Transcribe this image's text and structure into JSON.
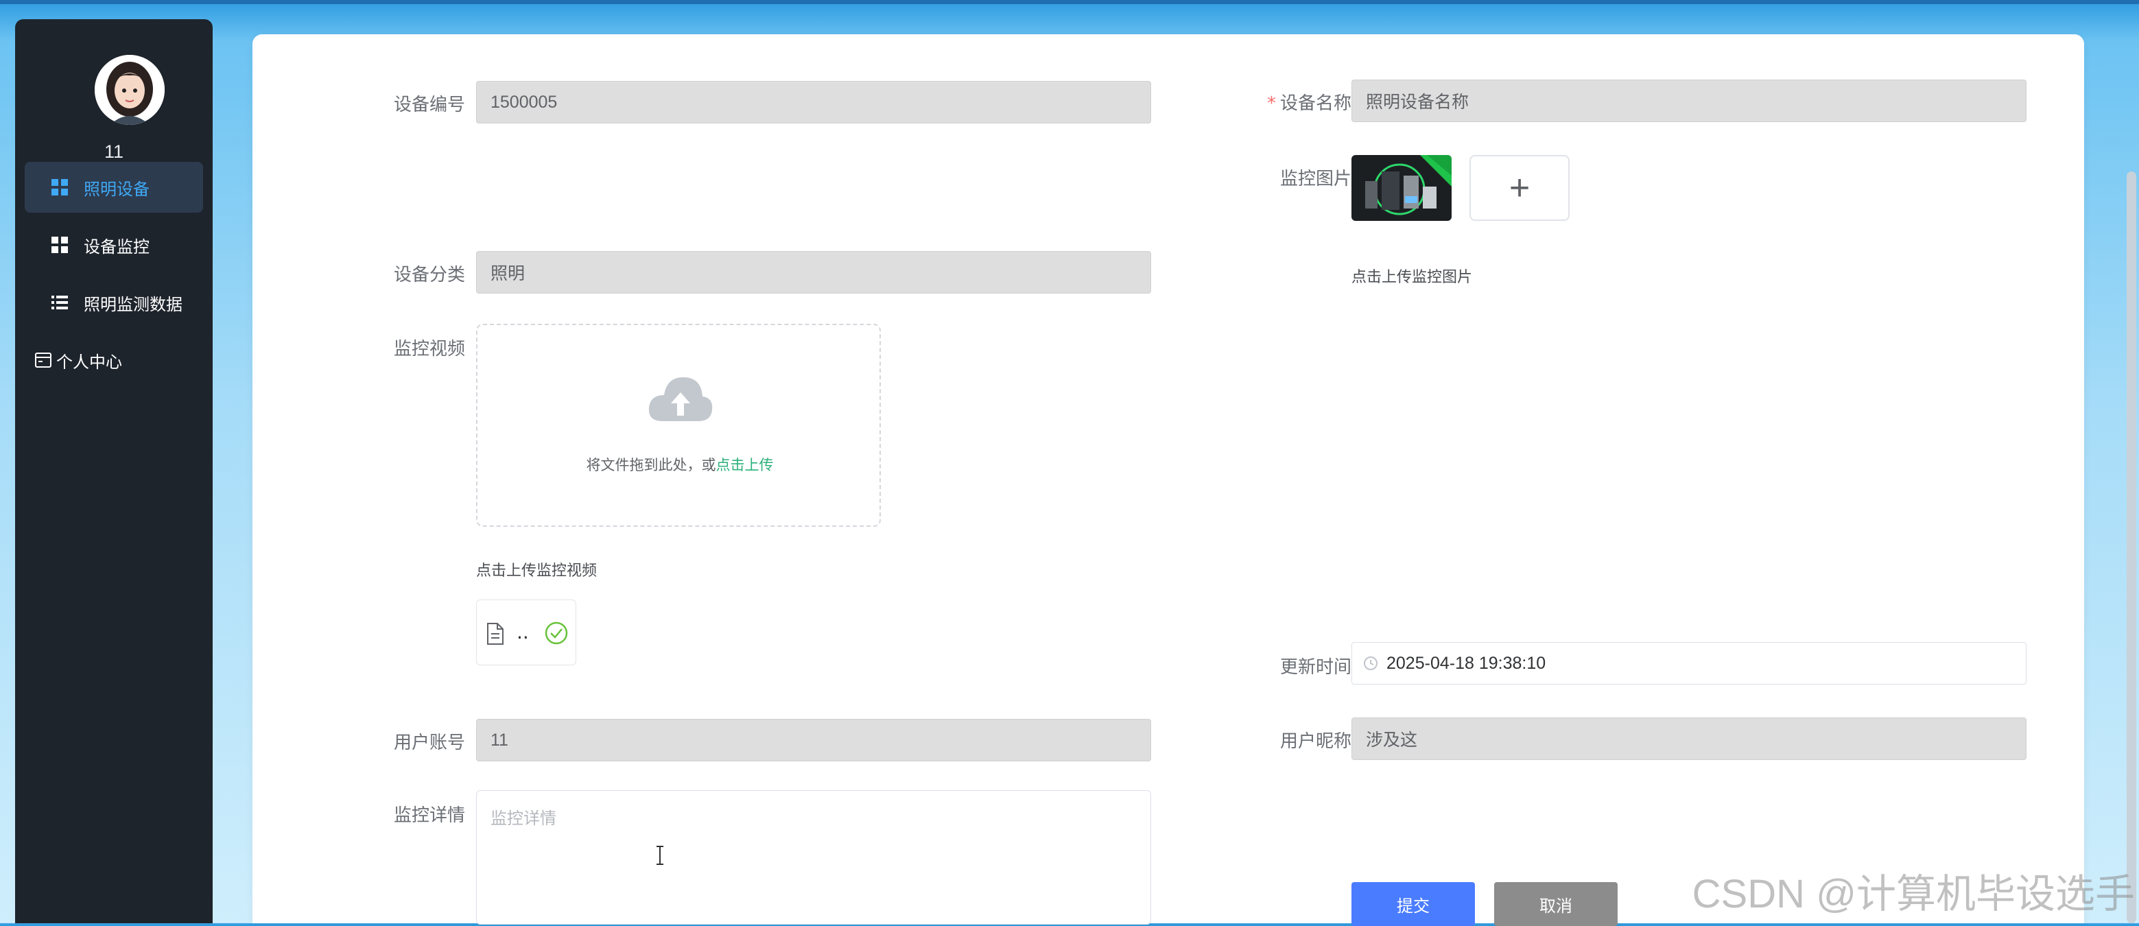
{
  "sidebar": {
    "username": "11",
    "items": [
      {
        "label": "照明设备",
        "icon": "grid-icon"
      },
      {
        "label": "设备监控",
        "icon": "grid-icon"
      },
      {
        "label": "照明监测数据",
        "icon": "list-icon"
      },
      {
        "label": "个人中心",
        "icon": "id-card-icon"
      }
    ]
  },
  "form": {
    "device_no": {
      "label": "设备编号",
      "value": "1500005"
    },
    "device_name": {
      "label": "设备名称",
      "required_mark": "*",
      "placeholder": "照明设备名称"
    },
    "monitor_image": {
      "label": "监控图片",
      "hint": "点击上传监控图片",
      "add_symbol": "+"
    },
    "category": {
      "label": "设备分类",
      "value": "照明"
    },
    "monitor_video": {
      "label": "监控视频",
      "drop_text": "将文件拖到此处，或",
      "drop_link": "点击上传",
      "hint": "点击上传监控视频",
      "file_name": ".."
    },
    "update_time": {
      "label": "更新时间",
      "value": "2025-04-18 19:38:10"
    },
    "user_account": {
      "label": "用户账号",
      "value": "11"
    },
    "user_nickname": {
      "label": "用户昵称",
      "value": "涉及这"
    },
    "monitor_detail": {
      "label": "监控详情",
      "placeholder": "监控详情"
    },
    "buttons": {
      "submit": "提交",
      "cancel": "取消"
    }
  },
  "colors": {
    "sidebar_bg": "#1e242c",
    "active_text": "#3fa9f5",
    "submit_btn": "#4a7cff",
    "cancel_btn": "#8c8c8c",
    "link": "#2bb07a"
  },
  "watermark": "CSDN @计算机毕设选手"
}
